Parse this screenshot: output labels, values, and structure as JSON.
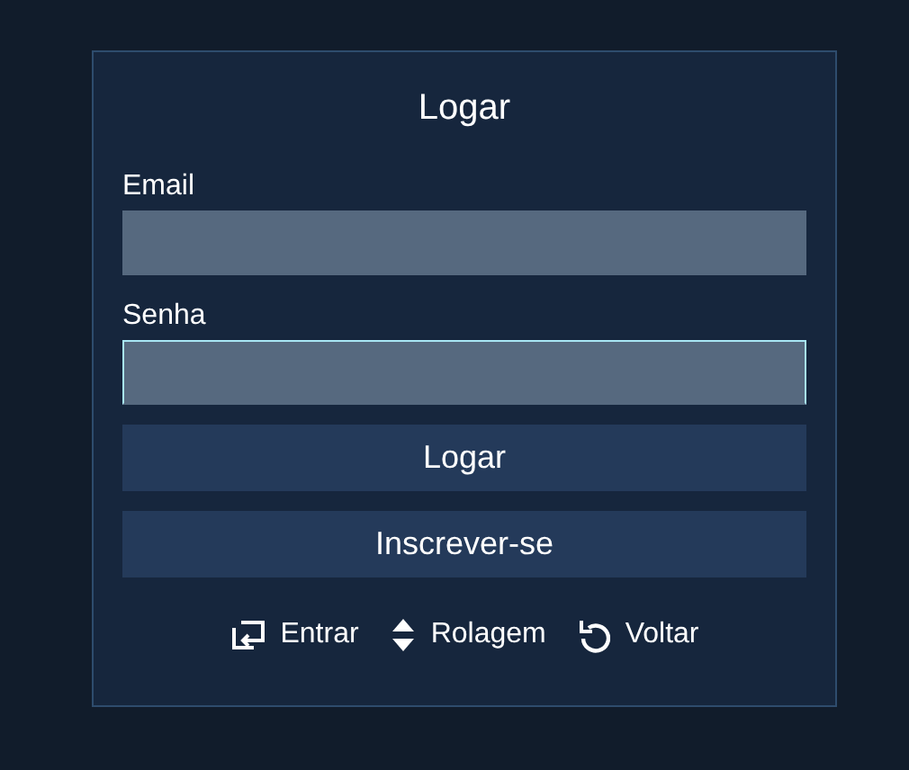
{
  "title": "Logar",
  "fields": [
    {
      "label": "Email",
      "focused": false
    },
    {
      "label": "Senha",
      "focused": true
    }
  ],
  "buttons": [
    "Logar",
    "Inscrever-se"
  ],
  "hints": [
    {
      "kind": "enter",
      "label": "Entrar"
    },
    {
      "kind": "scroll",
      "label": "Rolagem"
    },
    {
      "kind": "back",
      "label": "Voltar"
    }
  ]
}
